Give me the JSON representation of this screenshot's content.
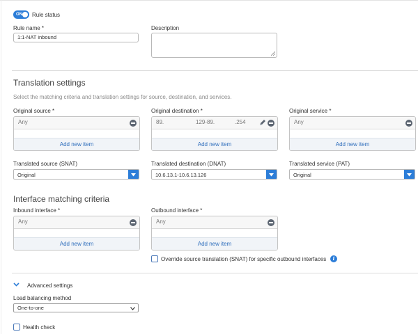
{
  "rule_status": {
    "label": "Rule status",
    "toggle_text": "ON"
  },
  "rule_name": {
    "label": "Rule name *",
    "value": "1:1-NAT inbound"
  },
  "description": {
    "label": "Description",
    "value": ""
  },
  "translation": {
    "title": "Translation settings",
    "desc": "Select the matching criteria and translation settings for source, destination, and services.",
    "original_source": {
      "label": "Original source *",
      "item": "Any",
      "add": "Add new item"
    },
    "original_destination": {
      "label": "Original destination *",
      "item_start": "89.",
      "item_mid": "129-89.",
      "item_end": ".254",
      "add": "Add new item"
    },
    "original_service": {
      "label": "Original service *",
      "item": "Any",
      "add": "Add new item"
    },
    "translated_source": {
      "label": "Translated source (SNAT)",
      "value": "Original"
    },
    "translated_destination": {
      "label": "Translated destination (DNAT)",
      "value": "10.6.13.1-10.6.13.126"
    },
    "translated_service": {
      "label": "Translated service (PAT)",
      "value": "Original"
    }
  },
  "interface": {
    "title": "Interface matching criteria",
    "inbound": {
      "label": "Inbound interface *",
      "item": "Any",
      "add": "Add new item"
    },
    "outbound": {
      "label": "Outbound interface *",
      "item": "Any",
      "add": "Add new item"
    },
    "override_label": "Override source translation (SNAT) for specific outbound interfaces",
    "info_glyph": "i"
  },
  "advanced": {
    "label": "Advanced settings",
    "lb_label": "Load balancing method",
    "lb_value": "One-to-one",
    "health_label": "Health check"
  },
  "colors": {
    "accent": "#2c7dd8",
    "link": "#2f6ebc",
    "icon_dark": "#5d6672"
  }
}
